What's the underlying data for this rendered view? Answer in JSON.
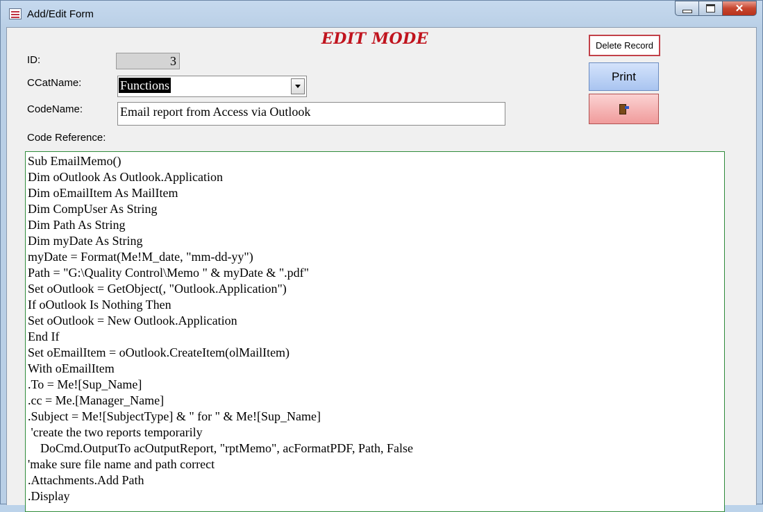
{
  "window": {
    "title": "Add/Edit Form"
  },
  "form": {
    "mode_title": "EDIT MODE",
    "id_label": "ID:",
    "id_value": "3",
    "ccat_label": "CCatName:",
    "ccat_value": "Functions",
    "codename_label": "CodeName:",
    "codename_value": "Email report from Access via Outlook",
    "code_ref_label": "Code Reference:",
    "code_lines": [
      "Sub EmailMemo()",
      "Dim oOutlook As Outlook.Application",
      "Dim oEmailItem As MailItem",
      "Dim CompUser As String",
      "Dim Path As String",
      "Dim myDate As String",
      "myDate = Format(Me!M_date, \"mm-dd-yy\")",
      "Path = \"G:\\Quality Control\\Memo \" & myDate & \".pdf\"",
      "Set oOutlook = GetObject(, \"Outlook.Application\")",
      "If oOutlook Is Nothing Then",
      "Set oOutlook = New Outlook.Application",
      "End If",
      "Set oEmailItem = oOutlook.CreateItem(olMailItem)",
      "With oEmailItem",
      ".To = Me![Sup_Name]",
      ".cc = Me.[Manager_Name]",
      ".Subject = Me![SubjectType] & \" for \" & Me![Sup_Name]",
      " 'create the two reports temporarily",
      "    DoCmd.OutputTo acOutputReport, \"rptMemo\", acFormatPDF, Path, False",
      "'make sure file name and path correct",
      ".Attachments.Add Path",
      ".Display"
    ]
  },
  "buttons": {
    "delete_label": "Delete Record",
    "print_label": "Print",
    "exit_icon": "exit-door-icon",
    "close_glyph": "✕"
  },
  "colors": {
    "mode_title": "#c0141e",
    "code_border": "#2e8b3a",
    "print_bg": "#b9d0f6",
    "exit_bg": "#f4b3b3",
    "delete_border": "#c24048"
  }
}
